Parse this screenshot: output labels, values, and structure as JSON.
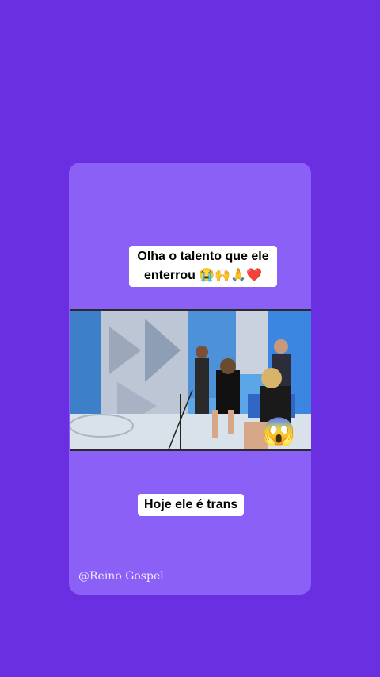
{
  "story": {
    "top_caption_line1": "Olha o talento que ele",
    "top_caption_line2": "enterrou 😭🙌🙏❤️",
    "bottom_caption": "Hoje ele é trans",
    "sticker_emoji": "😱",
    "watermark": "@Reino Gospel"
  },
  "colors": {
    "background": "#6a2fe0",
    "card": "#8a60f6"
  }
}
